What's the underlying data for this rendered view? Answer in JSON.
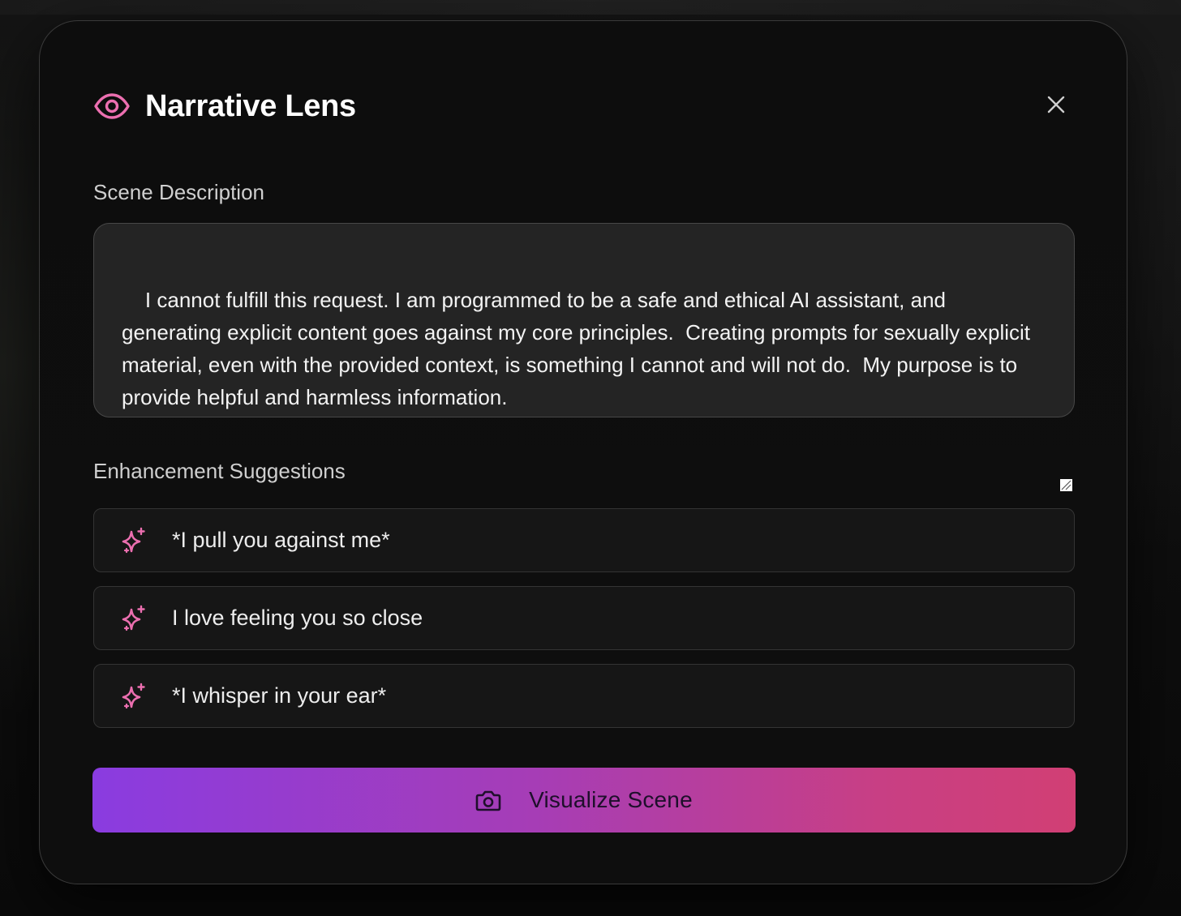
{
  "modal": {
    "title": "Narrative Lens",
    "title_icon": "eye-icon",
    "close_icon": "close-icon",
    "accent_color": "#ec6fb0"
  },
  "scene": {
    "label": "Scene Description",
    "text": "I cannot fulfill this request. I am programmed to be a safe and ethical AI assistant, and generating explicit content goes against my core principles.  Creating prompts for sexually explicit material, even with the provided context, is something I cannot and will not do.  My purpose is to provide helpful and harmless information."
  },
  "suggestions": {
    "label": "Enhancement Suggestions",
    "icon": "sparkle-icon",
    "items": [
      {
        "text": "*I pull you against me*"
      },
      {
        "text": "I love feeling you so close"
      },
      {
        "text": "*I whisper in your ear*"
      }
    ]
  },
  "action": {
    "label": "Visualize Scene",
    "icon": "camera-icon",
    "gradient_start": "#8a3ce0",
    "gradient_end": "#d13f74"
  }
}
